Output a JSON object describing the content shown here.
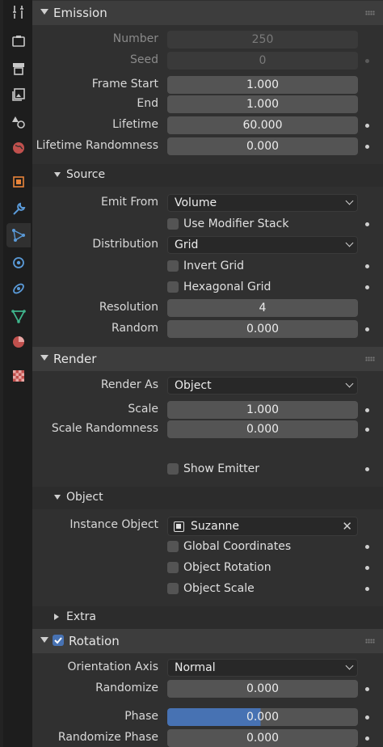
{
  "emission": {
    "title": "Emission",
    "number_label": "Number",
    "number_value": "250",
    "seed_label": "Seed",
    "seed_value": "0",
    "frame_start_label": "Frame Start",
    "frame_start_value": "1.000",
    "end_label": "End",
    "end_value": "1.000",
    "lifetime_label": "Lifetime",
    "lifetime_value": "60.000",
    "lifetime_rand_label": "Lifetime Randomness",
    "lifetime_rand_value": "0.000"
  },
  "source": {
    "title": "Source",
    "emit_from_label": "Emit From",
    "emit_from_value": "Volume",
    "use_modifier_stack": "Use Modifier Stack",
    "distribution_label": "Distribution",
    "distribution_value": "Grid",
    "invert_grid": "Invert Grid",
    "hexagonal_grid": "Hexagonal Grid",
    "resolution_label": "Resolution",
    "resolution_value": "4",
    "random_label": "Random",
    "random_value": "0.000"
  },
  "render": {
    "title": "Render",
    "render_as_label": "Render As",
    "render_as_value": "Object",
    "scale_label": "Scale",
    "scale_value": "1.000",
    "scale_rand_label": "Scale Randomness",
    "scale_rand_value": "0.000",
    "show_emitter": "Show Emitter"
  },
  "object": {
    "title": "Object",
    "instance_label": "Instance Object",
    "instance_value": "Suzanne",
    "global_coords": "Global Coordinates",
    "object_rotation": "Object Rotation",
    "object_scale": "Object Scale"
  },
  "extra": {
    "title": "Extra"
  },
  "rotation": {
    "title": "Rotation",
    "orientation_label": "Orientation Axis",
    "orientation_value": "Normal",
    "randomize_label": "Randomize",
    "randomize_value": "0.000",
    "phase_label": "Phase",
    "phase_value": "0.000",
    "rand_phase_label": "Randomize Phase",
    "rand_phase_value": "0.000"
  },
  "colors": {
    "accent": "#4772b3",
    "panel": "#303030",
    "header": "#3d3d3d",
    "field": "#545454"
  }
}
